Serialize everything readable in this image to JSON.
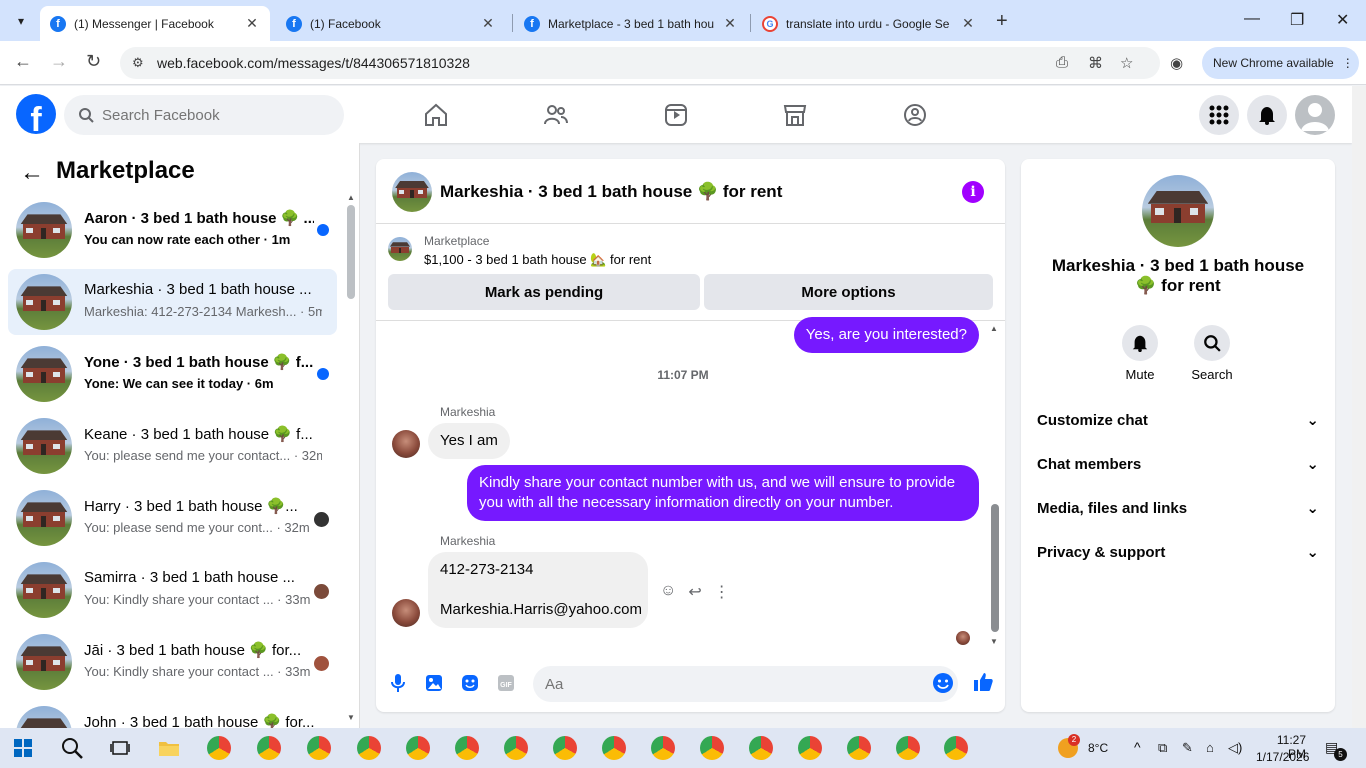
{
  "browser": {
    "tabs": [
      {
        "title": "(1) Messenger | Facebook",
        "favicon": "facebook-icon",
        "active": true
      },
      {
        "title": "(1) Facebook",
        "favicon": "facebook-icon",
        "active": false
      },
      {
        "title": "Marketplace - 3 bed 1 bath hou",
        "favicon": "facebook-icon",
        "active": false
      },
      {
        "title": "translate into urdu - Google Se",
        "favicon": "google-icon",
        "active": false
      }
    ],
    "url": "web.facebook.com/messages/t/844306571810328",
    "update_label": "New Chrome available"
  },
  "fb_header": {
    "search_placeholder": "Search Facebook",
    "brand_color": "#0866ff"
  },
  "sidebar": {
    "title": "Marketplace",
    "conversations": [
      {
        "name": "Aaron · 3 bed 1 bath house 🌳 ...",
        "preview": "You can now rate each other · 1m",
        "unread": true,
        "indicator": "dot"
      },
      {
        "name": "Markeshia · 3 bed 1 bath house ...",
        "preview": "Markeshia: 412-273-2134 Markesh... · 5m",
        "unread": false,
        "indicator": "none",
        "selected": true
      },
      {
        "name": "Yone · 3 bed 1 bath house 🌳 f...",
        "preview": "Yone: We can see it today · 6m",
        "unread": true,
        "indicator": "dot"
      },
      {
        "name": "Keane · 3 bed 1 bath house 🌳 f...",
        "preview": "You: please send me your contact... · 32m",
        "unread": false,
        "indicator": "none"
      },
      {
        "name": "Harry · 3 bed 1 bath house 🌳...",
        "preview": "You: please send me your cont... · 32m",
        "unread": false,
        "indicator": "avatar"
      },
      {
        "name": "Samirra · 3 bed 1 bath house ...",
        "preview": "You: Kindly share your contact ... · 33m",
        "unread": false,
        "indicator": "avatar"
      },
      {
        "name": "Jāi · 3 bed 1 bath house 🌳 for...",
        "preview": "You: Kindly share your contact ... · 33m",
        "unread": false,
        "indicator": "avatar"
      },
      {
        "name": "John · 3 bed 1 bath house 🌳 for...",
        "preview": "",
        "unread": false,
        "indicator": "none"
      }
    ]
  },
  "chat": {
    "title": "Markeshia · 3 bed 1 bath house 🌳 for rent",
    "marketplace_label": "Marketplace",
    "listing": "$1,100 - 3 bed 1 bath house 🏡 for rent",
    "mark_pending_label": "Mark as pending",
    "more_options_label": "More options",
    "messages": [
      {
        "from": "me",
        "text": "Yes, are you interested?"
      },
      {
        "type": "timestamp",
        "text": "11:07 PM"
      },
      {
        "from": "Markeshia",
        "sender_label": "Markeshia",
        "text": "Yes I am"
      },
      {
        "from": "me",
        "line1": "Kindly share your contact number with us, and we will ensure to provide",
        "line2": "you with all the necessary information directly on your number."
      },
      {
        "from": "Markeshia",
        "sender_label": "Markeshia",
        "line1": "412-273-2134",
        "line2": "Markeshia.Harris@yahoo.com"
      }
    ],
    "composer_placeholder": "Aa",
    "accent_color": "#7619ff"
  },
  "info_panel": {
    "name_line1": "Markeshia · 3 bed 1 bath house",
    "name_line2": "🌳 for rent",
    "mute_label": "Mute",
    "search_label": "Search",
    "sections": [
      "Customize chat",
      "Chat members",
      "Media, files and links",
      "Privacy & support"
    ]
  },
  "taskbar": {
    "weather": "8°C",
    "time": "11:27 PM",
    "date": "1/17/2026",
    "weather_badge": "2",
    "notification_count": "5"
  }
}
